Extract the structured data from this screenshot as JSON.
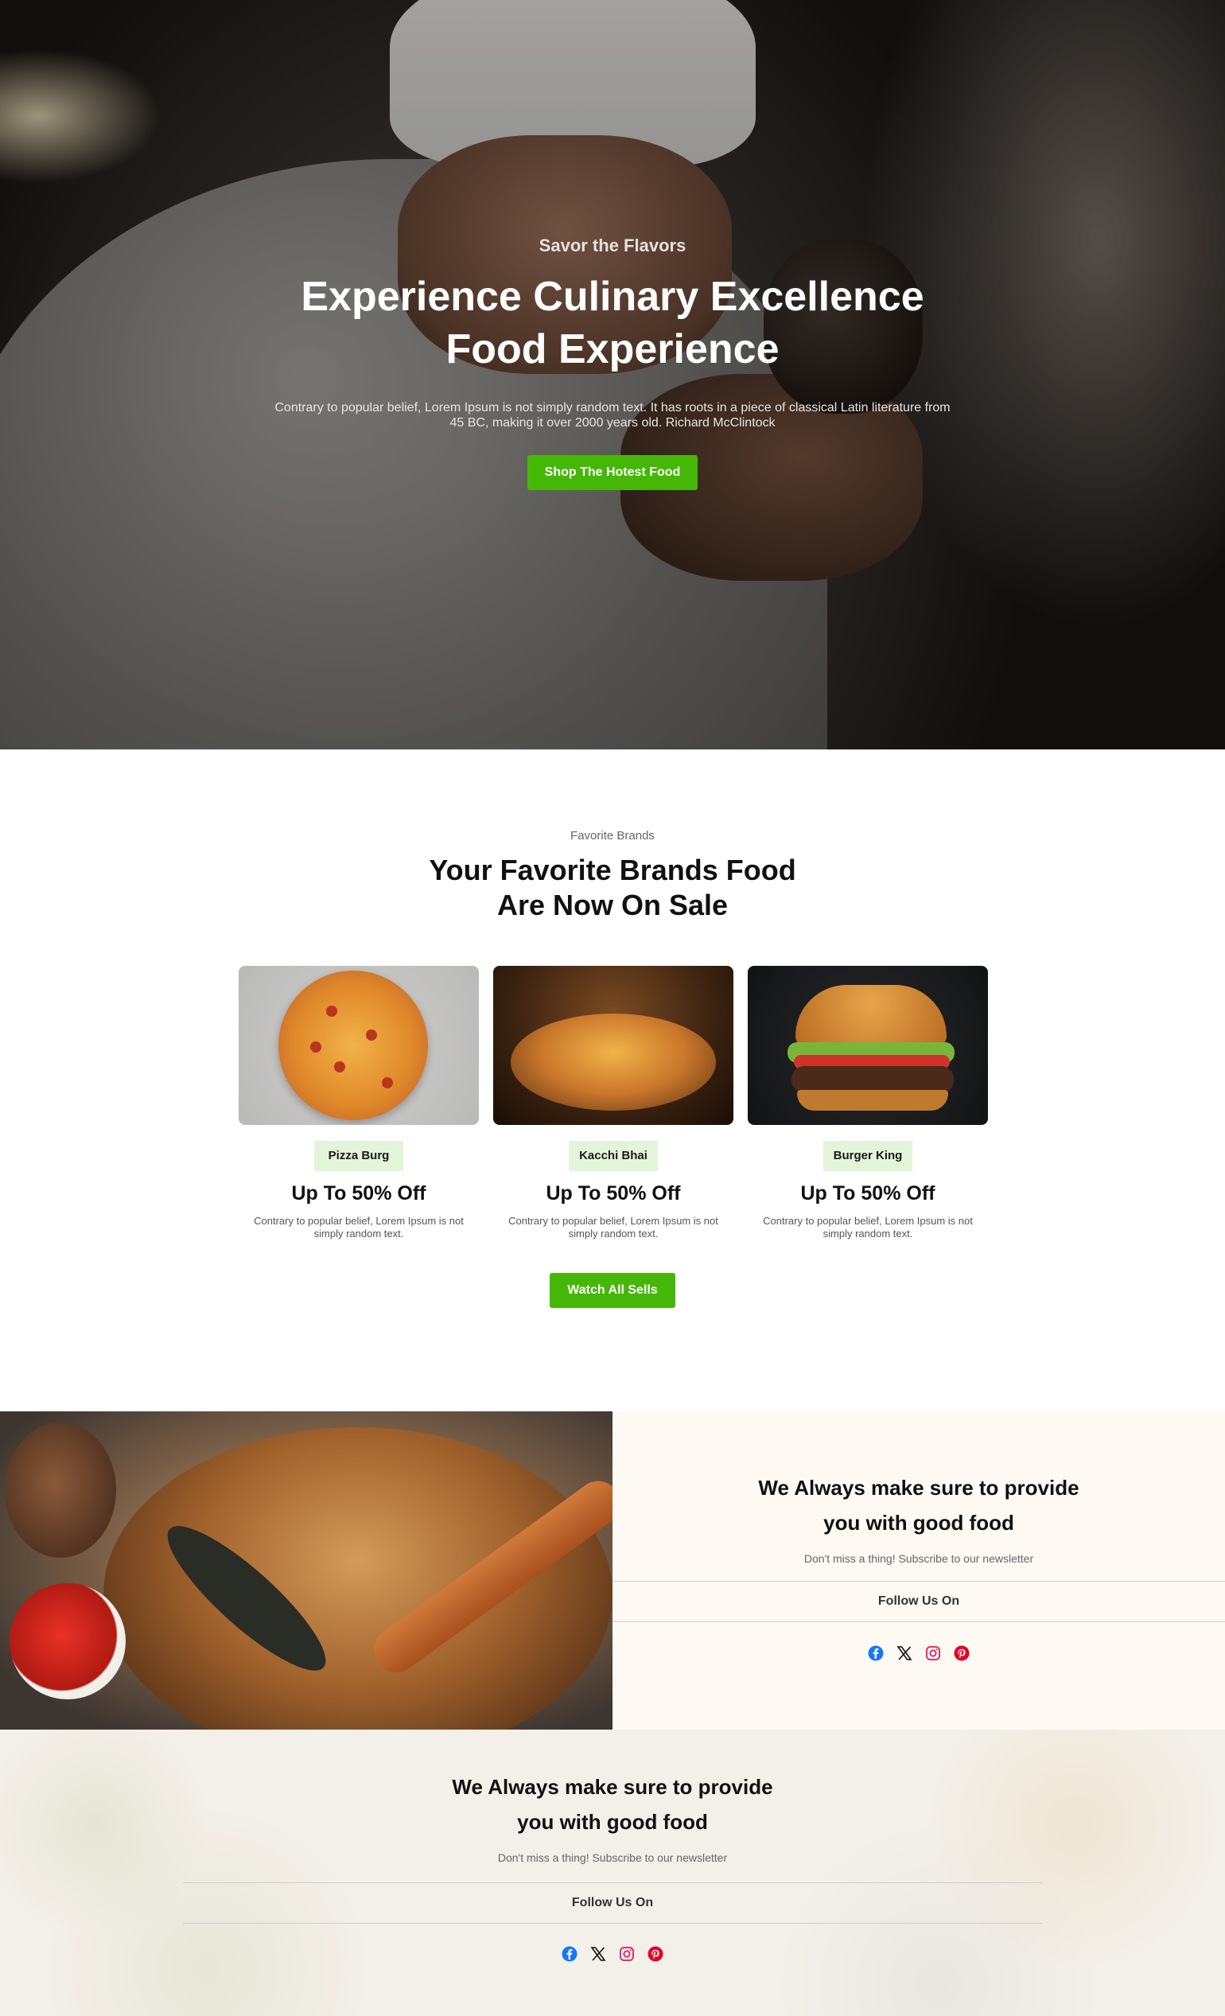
{
  "hero": {
    "eyebrow": "Savor the Flavors",
    "title_line1": "Experience Culinary Excellence",
    "title_line2": "Food Experience",
    "description": "Contrary to popular belief, Lorem Ipsum is not simply random text. It has roots in a piece of classical Latin literature from 45 BC, making it over 2000 years old. Richard McClintock",
    "cta_label": "Shop The Hotest Food"
  },
  "brands": {
    "eyebrow": "Favorite Brands",
    "title_line1": "Your Favorite Brands Food",
    "title_line2": "Are Now On Sale",
    "cards": [
      {
        "tag": "Pizza Burg",
        "offer": "Up To 50% Off",
        "description": "Contrary to popular belief, Lorem Ipsum is not simply random text."
      },
      {
        "tag": "Kacchi Bhai",
        "offer": "Up To 50% Off",
        "description": "Contrary to popular belief, Lorem Ipsum is not simply random text."
      },
      {
        "tag": "Burger King",
        "offer": "Up To 50% Off",
        "description": "Contrary to popular belief, Lorem Ipsum is not simply random text."
      }
    ],
    "watch_label": "Watch All Sells"
  },
  "newsletter": {
    "title_line1": "We Always make sure to provide",
    "title_line2": "you with good food",
    "subtitle": "Don't miss a thing! Subscribe to our newsletter",
    "follow_label": "Follow Us On"
  },
  "footer_newsletter": {
    "title_line1": "We Always make sure to provide",
    "title_line2": "you with good food",
    "subtitle": "Don't miss a thing! Subscribe to our newsletter",
    "follow_label": "Follow Us On"
  },
  "socials": [
    "facebook-icon",
    "x-icon",
    "instagram-icon",
    "pinterest-icon"
  ],
  "colors": {
    "accent": "#45b707",
    "tag_bg": "#e3f5d9",
    "panel_bg": "#fefaf3",
    "facebook": "#1877f2",
    "instagram": "#e1306c",
    "pinterest": "#e60023"
  }
}
